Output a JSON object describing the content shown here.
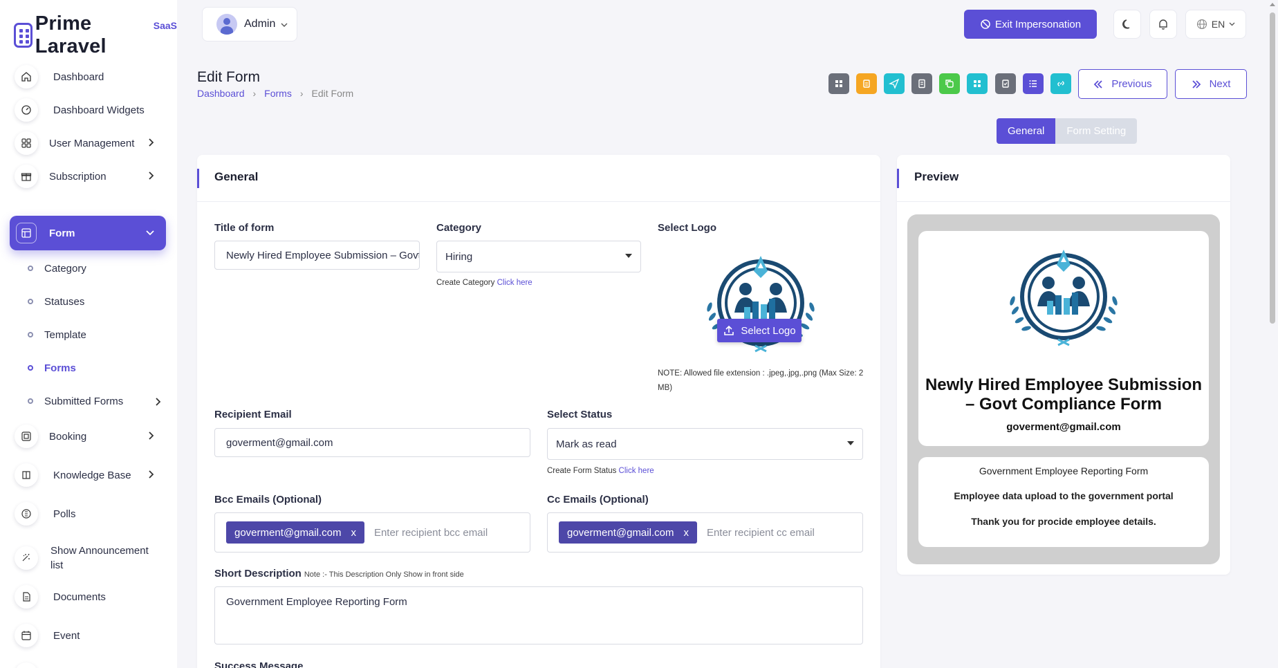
{
  "brand": {
    "name": "Prime Laravel",
    "sup": "SaaS"
  },
  "user": {
    "name": "Admin"
  },
  "topbar": {
    "exit_label": "Exit Impersonation",
    "lang": "EN"
  },
  "sidebar": {
    "items": [
      {
        "label": "Dashboard",
        "icon": "home-icon"
      },
      {
        "label": "Dashboard Widgets",
        "icon": "gauge-icon"
      },
      {
        "label": "User Management",
        "icon": "grid-icon"
      },
      {
        "label": "Subscription",
        "icon": "gift-icon"
      },
      {
        "label": "Form",
        "icon": "table-icon"
      },
      {
        "label": "Booking",
        "icon": "booking-icon"
      },
      {
        "label": "Knowledge Base",
        "icon": "book-icon"
      },
      {
        "label": "Polls",
        "icon": "poll-icon"
      },
      {
        "label": "Show Announcement list",
        "icon": "megaphone-icon"
      },
      {
        "label": "Documents",
        "icon": "document-icon"
      },
      {
        "label": "Event",
        "icon": "calendar-icon"
      }
    ],
    "form_sub": [
      "Category",
      "Statuses",
      "Template",
      "Forms",
      "Submitted Forms"
    ]
  },
  "page": {
    "title": "Edit Form",
    "breadcrumb": [
      "Dashboard",
      "Forms",
      "Edit Form"
    ],
    "prev_label": "Previous",
    "next_label": "Next",
    "tabs": [
      "General",
      "Form Setting"
    ],
    "tool_colors": [
      "#6b6f7a",
      "#f5a623",
      "#22bfd0",
      "#6b6f7a",
      "#4cc94a",
      "#22bfd0",
      "#6b6f7a",
      "#5b4fd6",
      "#22bfd0"
    ]
  },
  "general": {
    "heading": "General",
    "title_label": "Title of form",
    "title_value": "Newly Hired Employee Submission – Govt Compliance Form",
    "category_label": "Category",
    "category_value": "Hiring",
    "create_category_text": "Create Category",
    "click_here": "Click here",
    "logo_label": "Select Logo",
    "logo_button": "Select Logo",
    "logo_note": "NOTE: Allowed file extension : .jpeg,.jpg,.png (Max Size: 2 MB)",
    "recipient_label": "Recipient Email",
    "recipient_value": "goverment@gmail.com",
    "status_label": "Select Status",
    "status_value": "Mark as read",
    "create_status_text": "Create Form Status",
    "bcc_label": "Bcc Emails (Optional)",
    "bcc_tag": "goverment@gmail.com",
    "bcc_placeholder": "Enter recipient bcc email",
    "cc_label": "Cc Emails (Optional)",
    "cc_tag": "goverment@gmail.com",
    "cc_placeholder": "Enter recipient cc email",
    "short_desc_label": "Short Description",
    "short_desc_note": "Note :- This Description Only Show in front side",
    "short_desc_value": "Government Employee Reporting Form",
    "success_label": "Success Message"
  },
  "preview": {
    "heading": "Preview",
    "title": "Newly Hired Employee Submission – Govt Compliance Form",
    "email": "goverment@gmail.com",
    "line1": "Government Employee Reporting Form",
    "line2": "Employee data upload to the government portal",
    "line3": "Thank you for procide employee details."
  }
}
